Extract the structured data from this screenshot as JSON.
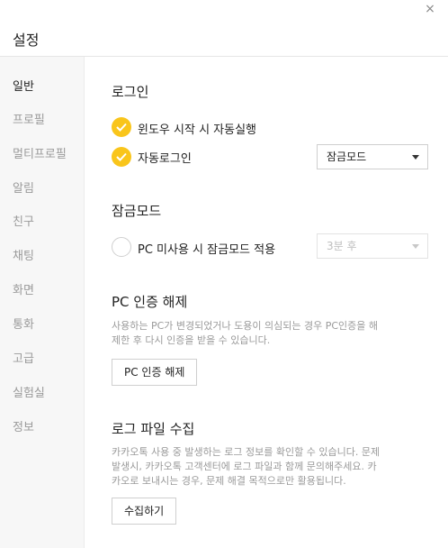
{
  "window": {
    "title": "설정",
    "close_label": "×"
  },
  "sidebar": {
    "items": [
      {
        "label": "일반",
        "active": true
      },
      {
        "label": "프로필"
      },
      {
        "label": "멀티프로필"
      },
      {
        "label": "알림"
      },
      {
        "label": "친구"
      },
      {
        "label": "채팅"
      },
      {
        "label": "화면"
      },
      {
        "label": "통화"
      },
      {
        "label": "고급"
      },
      {
        "label": "실험실"
      },
      {
        "label": "정보"
      }
    ]
  },
  "login": {
    "title": "로그인",
    "auto_start_label": "윈도우 시작 시 자동실행",
    "auto_start_checked": true,
    "auto_login_label": "자동로그인",
    "auto_login_checked": true,
    "auto_login_mode": "잠금모드"
  },
  "lock": {
    "title": "잠금모드",
    "idle_lock_label": "PC 미사용 시 잠금모드 적용",
    "idle_lock_checked": false,
    "idle_time": "3분 후"
  },
  "pc_auth": {
    "title": "PC 인증 해제",
    "description_line1": "사용하는 PC가 변경되었거나 도용이 의심되는 경우 PC인증을 해",
    "description_line2": "제한 후 다시 인증을 받을 수 있습니다.",
    "button_label": "PC 인증 해제"
  },
  "log": {
    "title": "로그 파일 수집",
    "description_line1": "카카오톡 사용 중 발생하는 로그 정보를 확인할 수 있습니다. 문제",
    "description_line2": " 발생시, 카카오톡 고객센터에 로그 파일과 함께 문의해주세요. 카",
    "description_line3": "카오로 보내시는 경우, 문제 해결 목적으로만 활용됩니다.",
    "button_label": "수집하기"
  },
  "colors": {
    "accent": "#f9c51b",
    "sidebar_bg": "#f7f7f7",
    "muted_text": "#9a9a9a"
  }
}
